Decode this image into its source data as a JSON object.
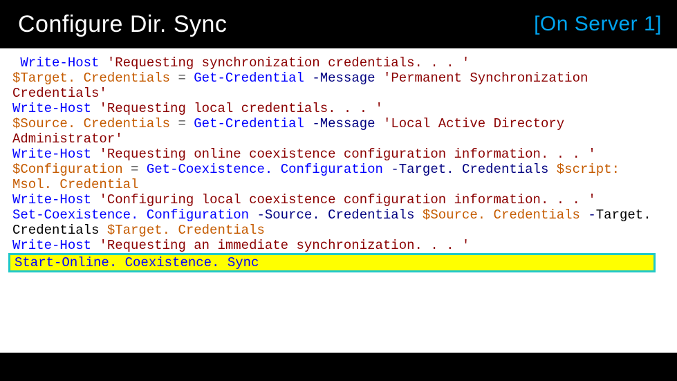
{
  "header": {
    "title": "Configure Dir. Sync",
    "subtitle": "[On Server 1]"
  },
  "code": {
    "l1_pre": " ",
    "l1_cmd": "Write-Host",
    "l1_sp": " ",
    "l1_str": "'Requesting synchronization credentials. . . '",
    "l2_var": "$Target. Credentials",
    "l2_sp1": " ",
    "l2_op": "=",
    "l2_sp2": " ",
    "l2_cmd": "Get-Credential",
    "l2_sp3": " ",
    "l2_param": "-Message",
    "l2_sp4": " ",
    "l2_str1": "'Permanent Synchronization Credentials'",
    "l4_cmd": "Write-Host",
    "l4_sp": " ",
    "l4_str": "'Requesting local credentials. . . '",
    "l5_var": "$Source. Credentials",
    "l5_sp1": " ",
    "l5_op": "=",
    "l5_sp2": " ",
    "l5_cmd": "Get-Credential",
    "l5_sp3": " ",
    "l5_param": "-Message",
    "l5_sp4": " ",
    "l5_str1": "'Local Active Directory Administrator'",
    "l7_cmd": "Write-Host",
    "l7_sp": " ",
    "l7_str": "'Requesting online coexistence configuration information. . . '",
    "l8_var": "$Configuration",
    "l8_sp1": " ",
    "l8_op": "=",
    "l8_sp2": " ",
    "l8_cmd": "Get-Coexistence. Configuration",
    "l8_sp3": " ",
    "l8_param": "-Target. Credentials",
    "l8_sp4": " ",
    "l8_var2": "$script: Msol. Credential",
    "l10_cmd": "Write-Host",
    "l10_sp": " ",
    "l10_str": "'Configuring local coexistence configuration information. . . '",
    "l11_cmd": "Set-Coexistence. Configuration",
    "l11_sp1": " ",
    "l11_param1": "-Source. Credentials",
    "l11_sp2": " ",
    "l11_var1": "$Source. Credentials",
    "l11_sp3": " ",
    "l11_dash": "-",
    "l11_plain": "Target. Credentials",
    "l11_sp4": " ",
    "l11_var2": "$Target. Credentials",
    "l13_cmd": "Write-Host",
    "l13_sp": " ",
    "l13_str": "'Requesting an immediate synchronization. . . '",
    "l14_cmd": "Start-Online. Coexistence. Sync"
  }
}
